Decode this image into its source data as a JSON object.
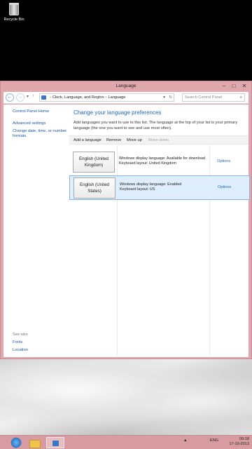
{
  "desktop": {
    "recycle_bin_label": "Recycle Bin"
  },
  "window": {
    "title": "Language",
    "controls": {
      "minimize": "–",
      "maximize": "□",
      "close": "✕"
    }
  },
  "address": {
    "back": "←",
    "forward": "→",
    "recent": "▾",
    "up": "↑",
    "path": [
      "Clock, Language, and Region",
      "Language"
    ],
    "separator": "›",
    "dropdown": "▾",
    "refresh": "↻",
    "search_placeholder": "Search Control Panel",
    "search_icon": "⌕"
  },
  "sidebar": {
    "home": "Control Panel Home",
    "links": [
      "Advanced settings",
      "Change date, time, or number formats"
    ],
    "see_also_label": "See also",
    "see_also": [
      "Fonts",
      "Location"
    ]
  },
  "main": {
    "heading": "Change your language preferences",
    "intro": "Add languages you want to use to this list. The language at the top of your list is your primary language (the one you want to see and use most often).",
    "toolbar": [
      {
        "label": "Add a language",
        "enabled": true
      },
      {
        "label": "Remove",
        "enabled": true
      },
      {
        "label": "Move up",
        "enabled": true
      },
      {
        "label": "Move down",
        "enabled": false
      }
    ],
    "languages": [
      {
        "name": "English (United Kingdom)",
        "display_line": "Windows display language: Available for download",
        "keyboard_line": "Keyboard layout: United Kingdom",
        "options": "Options",
        "selected": false
      },
      {
        "name": "English (United States)",
        "display_line": "Windows display language: Enabled",
        "keyboard_line": "Keyboard layout: US",
        "options": "Options",
        "selected": true
      }
    ]
  },
  "taskbar": {
    "tray_arrow": "▲",
    "tray_language": "ENG",
    "time": "09:18",
    "date": "17-10-2013"
  },
  "colors": {
    "window_frame": "#e0a8ac",
    "link": "#1f56a8",
    "heading": "#2667b5",
    "selection": "#dfeefc"
  }
}
